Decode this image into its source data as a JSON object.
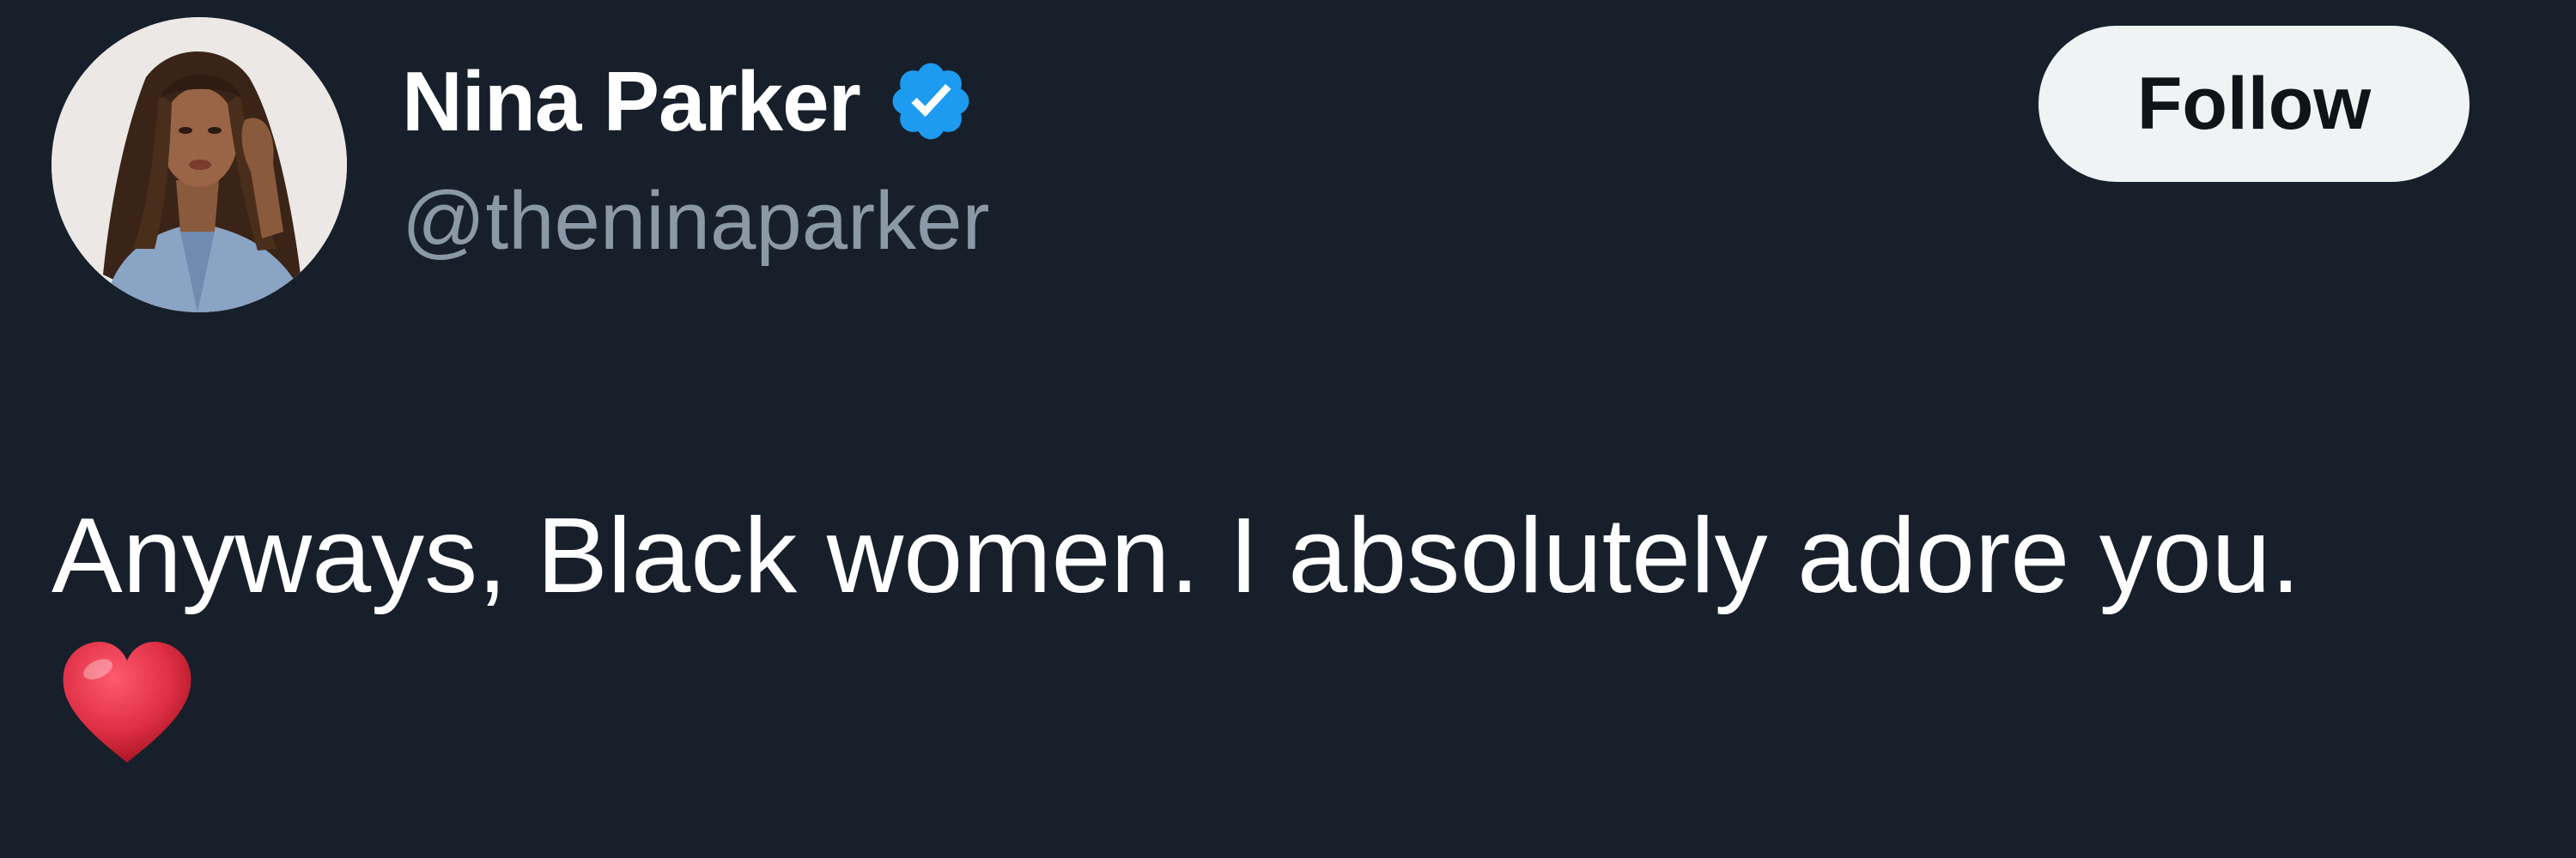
{
  "tweet": {
    "author": {
      "display_name": "Nina Parker",
      "handle": "@theninaparker",
      "verified": true,
      "avatar_icon": "profile-photo"
    },
    "follow_button_label": "Follow",
    "text": "Anyways, Black women. I absolutely adore you.",
    "emoji": "heart-icon"
  },
  "colors": {
    "background": "#17202a",
    "name_text": "#ffffff",
    "handle_text": "#8b98a5",
    "verified_badge": "#1d9bf0",
    "follow_button_bg": "#eff3f4",
    "follow_button_text": "#0f1419",
    "heart": "#dd2e44"
  }
}
